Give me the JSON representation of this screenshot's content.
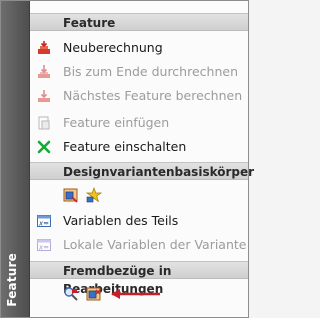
{
  "sidebar": {
    "title": "Feature"
  },
  "sections": {
    "feature": {
      "header": "Feature"
    },
    "design_variants": {
      "header": "Designvariantenbasiskörper"
    },
    "references": {
      "header": "Fremdbezüge in Bearbeitungen"
    }
  },
  "menu": {
    "recalculate": "Neuberechnung",
    "calc_to_end": "Bis zum Ende durchrechnen",
    "calc_next": "Nächstes Feature berechnen",
    "insert_feature": "Feature einfügen",
    "enable_feature": "Feature einschalten",
    "part_variables": "Variablen des Teils",
    "local_variables": "Lokale Variablen der Variante"
  },
  "icons": {
    "recalculate": "recalculate-icon",
    "calc_to_end": "calculate-to-end-icon",
    "calc_next": "calculate-next-icon",
    "insert_feature": "insert-feature-icon",
    "enable_feature": "green-x-icon",
    "part_variables": "variables-icon",
    "local_variables": "local-variables-icon"
  },
  "colors": {
    "sidebar": "#5e5e5e",
    "header": "#d6d6d6",
    "disabled_text": "#9c9c9c",
    "arrow": "#c8202a",
    "enable_icon": "#17a83a"
  }
}
